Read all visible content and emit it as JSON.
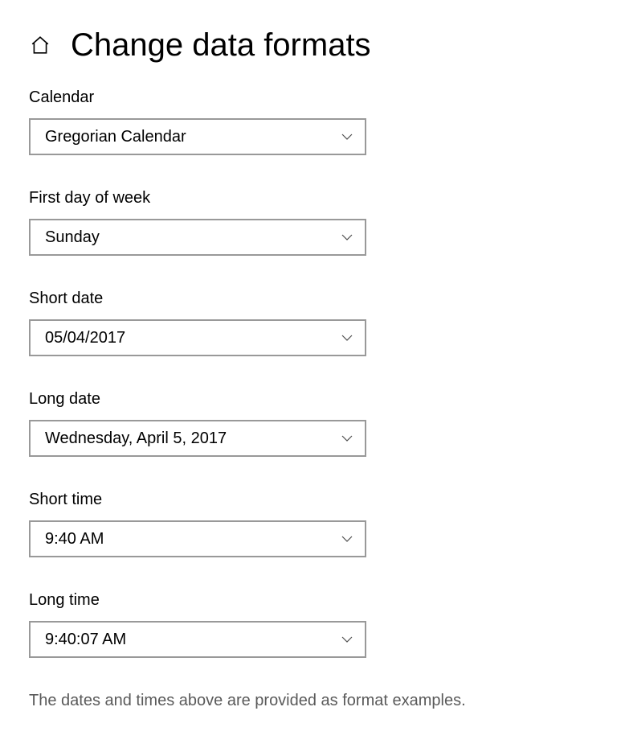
{
  "header": {
    "title": "Change data formats"
  },
  "fields": {
    "calendar": {
      "label": "Calendar",
      "value": "Gregorian Calendar"
    },
    "first_day": {
      "label": "First day of week",
      "value": "Sunday"
    },
    "short_date": {
      "label": "Short date",
      "value": "05/04/2017"
    },
    "long_date": {
      "label": "Long date",
      "value": "Wednesday, April 5, 2017"
    },
    "short_time": {
      "label": "Short time",
      "value": "9:40 AM"
    },
    "long_time": {
      "label": "Long time",
      "value": "9:40:07 AM"
    }
  },
  "footer_note": "The dates and times above are provided as format examples."
}
